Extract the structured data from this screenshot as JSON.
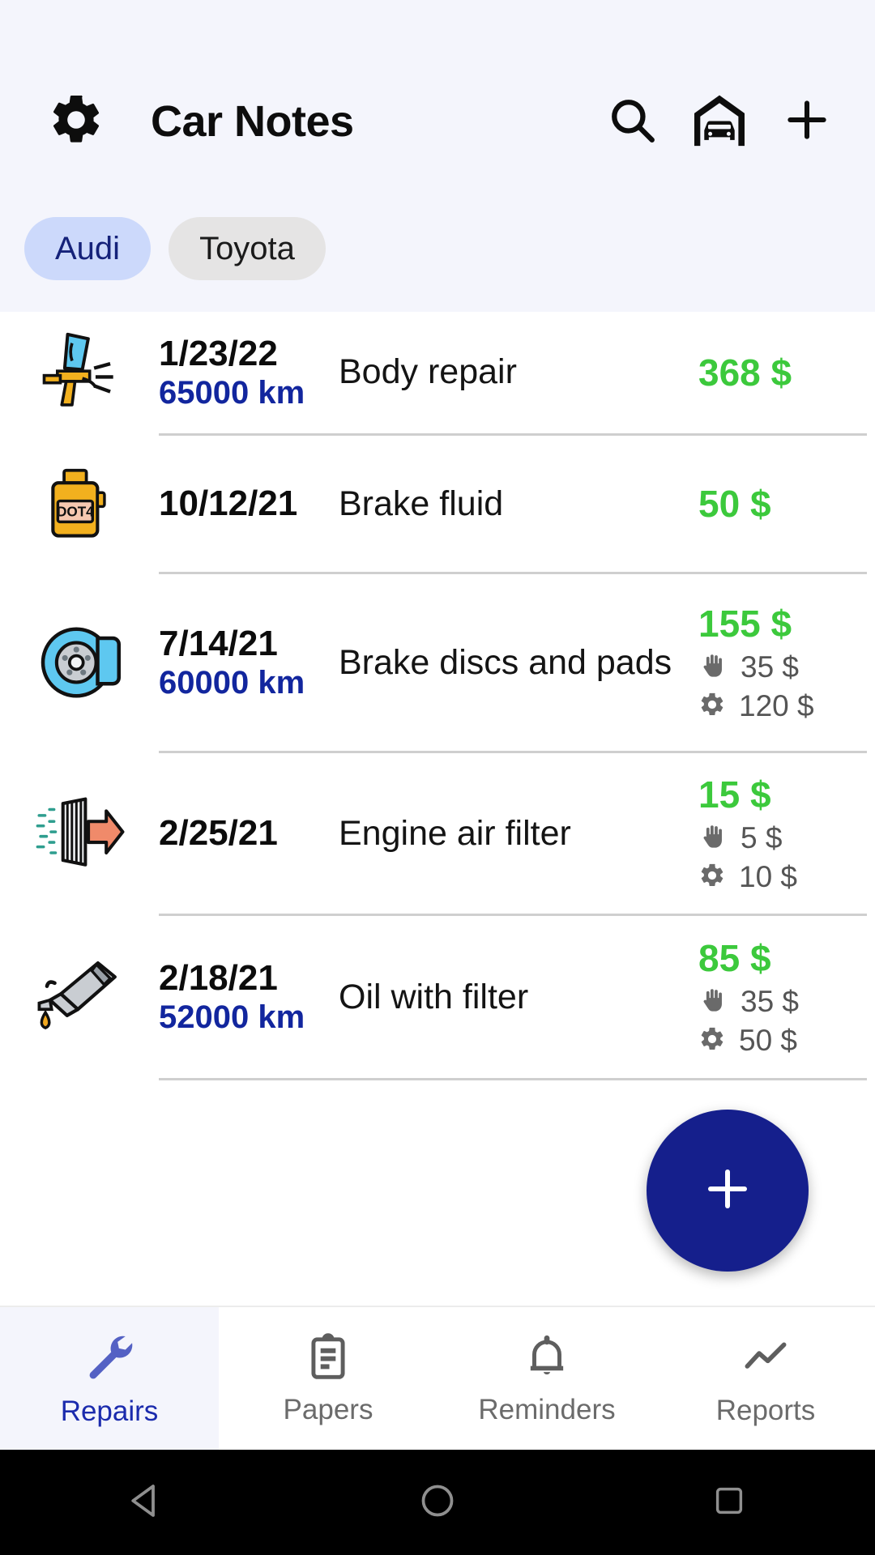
{
  "header": {
    "title": "Car Notes",
    "settings_icon": "gear-icon",
    "search_icon": "search-icon",
    "garage_icon": "garage-icon",
    "add_icon": "plus-icon",
    "background": "#f4f5fc"
  },
  "chips": [
    {
      "label": "Audi",
      "selected": true,
      "bg": "#ccd9fb",
      "fg": "#15227a"
    },
    {
      "label": "Toyota",
      "selected": false,
      "bg": "#e5e4e4",
      "fg": "#1b1b1b"
    }
  ],
  "colors": {
    "price_green": "#3cc93c",
    "odometer_blue": "#12269e",
    "accent_navy": "#151f8c",
    "subtotal_gray": "#555555"
  },
  "repairs": [
    {
      "icon": "spray-gun-icon",
      "date": "1/23/22",
      "odometer": "65000 km",
      "description": "Body repair",
      "total": "368 $",
      "labor": null,
      "parts": null
    },
    {
      "icon": "brake-fluid-bottle-icon",
      "date": "10/12/21",
      "odometer": "",
      "description": "Brake fluid",
      "total": "50 $",
      "labor": null,
      "parts": null
    },
    {
      "icon": "brake-disc-icon",
      "date": "7/14/21",
      "odometer": "60000 km",
      "description": "Brake discs and pads",
      "total": "155 $",
      "labor": "35 $",
      "parts": "120 $"
    },
    {
      "icon": "air-filter-icon",
      "date": "2/25/21",
      "odometer": "",
      "description": "Engine air filter",
      "total": "15 $",
      "labor": "5 $",
      "parts": "10 $"
    },
    {
      "icon": "oil-can-icon",
      "date": "2/18/21",
      "odometer": "52000 km",
      "description": "Oil with filter",
      "total": "85 $",
      "labor": "35 $",
      "parts": "50 $"
    }
  ],
  "fab": {
    "icon": "plus-icon",
    "color": "#151f8c"
  },
  "bottom_nav": [
    {
      "label": "Repairs",
      "icon": "wrench-icon",
      "active": true
    },
    {
      "label": "Papers",
      "icon": "clipboard-icon",
      "active": false
    },
    {
      "label": "Reminders",
      "icon": "bell-icon",
      "active": false
    },
    {
      "label": "Reports",
      "icon": "line-chart-icon",
      "active": false
    }
  ],
  "system_bar": [
    {
      "name": "back-button",
      "icon": "triangle-left-icon"
    },
    {
      "name": "home-button",
      "icon": "circle-icon"
    },
    {
      "name": "recents-button",
      "icon": "square-icon"
    }
  ]
}
